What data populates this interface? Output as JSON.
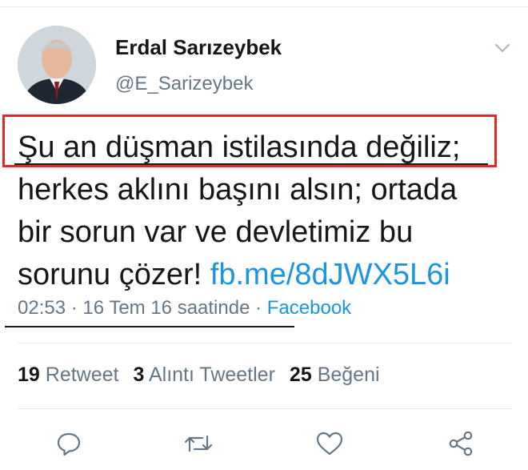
{
  "user": {
    "display_name": "Erdal Sarızeybek",
    "handle": "@E_Sarizeybek"
  },
  "tweet": {
    "lines": [
      "Şu an düşman istilasında değiliz;",
      "herkes aklını başını alsın; ortada",
      "bir sorun var ve devletimiz bu"
    ],
    "last_line_text": "sorunu çözer! ",
    "link_text": "fb.me/8dJWX5L6i"
  },
  "meta": {
    "timestamp": "02:53 · 16 Tem 16 saatinde · ",
    "source": "Facebook"
  },
  "stats": {
    "retweets_count": "19",
    "retweets_label": "Retweet",
    "quotes_count": "3",
    "quotes_label": "Alıntı Tweetler",
    "likes_count": "25",
    "likes_label": "Beğeni"
  },
  "icons": {
    "reply": "reply-icon",
    "retweet": "retweet-icon",
    "like": "heart-icon",
    "share": "share-icon",
    "more": "chevron-down-icon"
  },
  "colors": {
    "link": "#1b95e0",
    "secondary_text": "#657786",
    "annotation_box": "#e02a2a"
  }
}
